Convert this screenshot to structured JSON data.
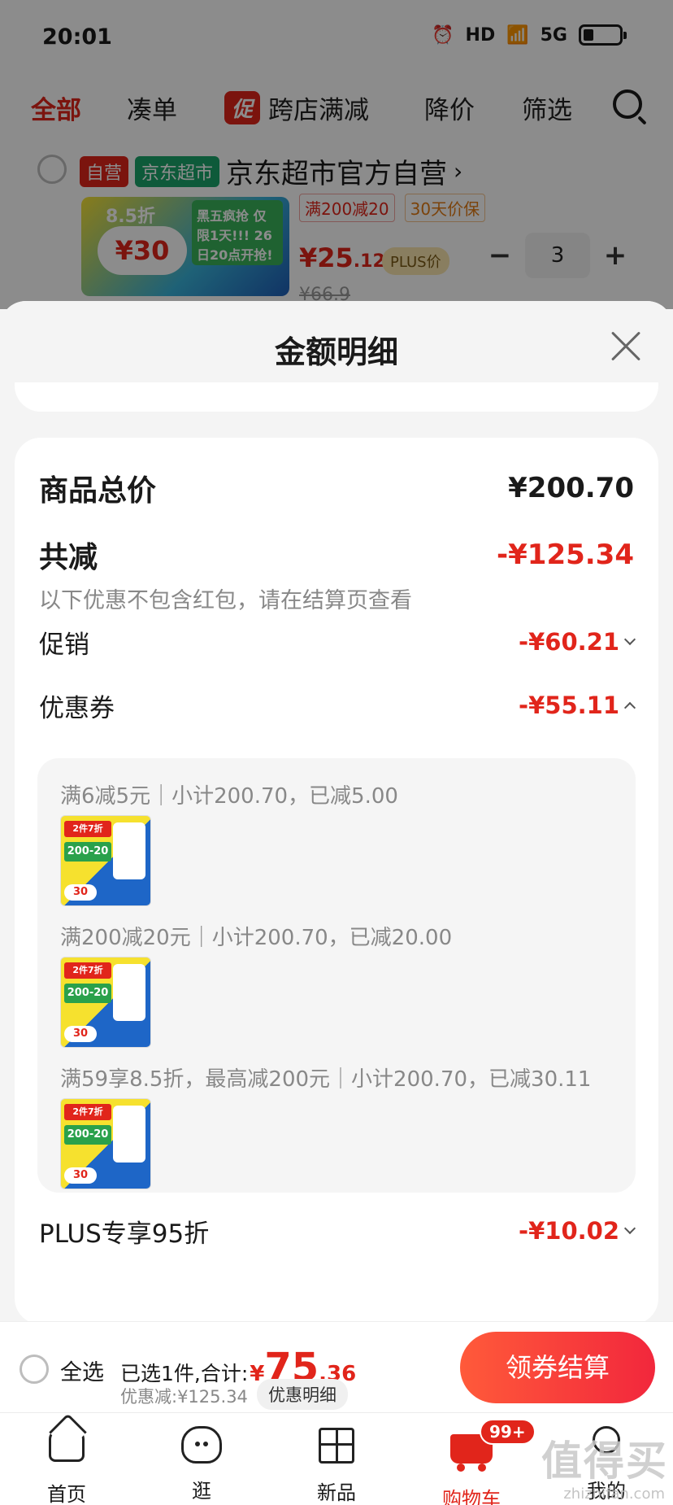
{
  "status_bar": {
    "time": "20:01",
    "hd": "HD",
    "network": "5G"
  },
  "top_tabs": {
    "all": "全部",
    "bundle": "凑单",
    "promo_badge": "促",
    "cross_store": "跨店满减",
    "price_drop": "降价",
    "filter": "筛选"
  },
  "shop": {
    "tag_self": "自营",
    "tag_jd": "京东超市",
    "name": "京东超市官方自营",
    "product": {
      "coupon_tags": [
        "满200减20",
        "30天价保"
      ],
      "price_main": "¥25",
      "price_decimal": ".12",
      "plus_tag": "PLUS价",
      "quantity": "3",
      "old_price": "¥66.9",
      "img_text_85": "8.5折",
      "img_text_30": "¥30",
      "img_text_sale": "黑五疯抢 仅限1天!!! 26日20点开抢!"
    }
  },
  "sheet": {
    "title": "金额明细",
    "total_label": "商品总价",
    "total_value": "¥200.70",
    "reduce_label": "共减",
    "reduce_value": "-¥125.34",
    "note": "以下优惠不包含红包，请在结算页查看",
    "promo_label": "促销",
    "promo_value": "-¥60.21",
    "coupon_label": "优惠券",
    "coupon_value": "-¥55.11",
    "coupons": [
      {
        "desc": "满6减5元｜小计200.70，已减5.00"
      },
      {
        "desc": "满200减20元｜小计200.70，已减20.00"
      },
      {
        "desc": "满59享8.5折，最高减200元｜小计200.70，已减30.11"
      }
    ],
    "thumb": {
      "t1": "2件7折",
      "t2": "200-20",
      "t3": "30"
    },
    "plus_label": "PLUS专享95折",
    "plus_value": "-¥10.02"
  },
  "checkout": {
    "select_all": "全选",
    "selected": "已选1件,合计:",
    "yen": "¥",
    "amount_int": "75",
    "amount_dec": ".36",
    "saved": "优惠减:¥125.34",
    "detail_btn": "优惠明细",
    "submit": "领券结算"
  },
  "tabbar": {
    "home": "首页",
    "browse": "逛",
    "new": "新品",
    "cart": "购物车",
    "cart_badge": "99+",
    "me": "我的"
  },
  "watermark": {
    "main": "值得买",
    "sub": "zhizhifan.com"
  }
}
